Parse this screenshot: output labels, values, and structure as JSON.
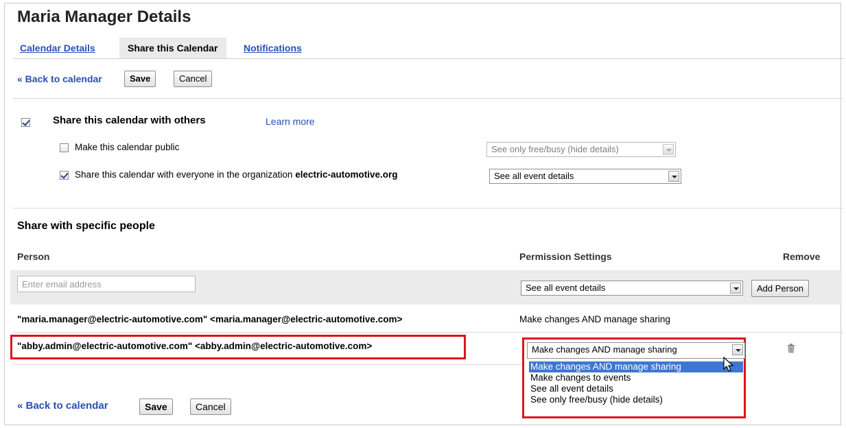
{
  "page": {
    "title": "Maria Manager Details"
  },
  "tabs": [
    {
      "label": "Calendar Details",
      "active": false
    },
    {
      "label": "Share this Calendar",
      "active": true
    },
    {
      "label": "Notifications",
      "active": false
    }
  ],
  "top_actions": {
    "back_label": "« Back to calendar",
    "save_label": "Save",
    "cancel_label": "Cancel"
  },
  "share_section": {
    "share_with_others_label": "Share this calendar with others",
    "share_with_others_checked": true,
    "learn_more": "Learn more",
    "public": {
      "label": "Make this calendar public",
      "checked": false,
      "select_value": "See only free/busy (hide details)"
    },
    "org": {
      "label_prefix": "Share this calendar with everyone in the organization",
      "org_name": "electric-automotive.org",
      "checked": true,
      "select_value": "See all event details"
    }
  },
  "specific_people": {
    "heading": "Share with specific people",
    "col_person": "Person",
    "col_permission": "Permission Settings",
    "col_remove": "Remove",
    "email_placeholder": "Enter email address",
    "new_permission_value": "See all event details",
    "add_person_label": "Add Person",
    "rows": [
      {
        "person": "\"maria.manager@electric-automotive.com\" <maria.manager@electric-automotive.com>",
        "permission": "Make changes AND manage sharing"
      },
      {
        "person": "\"abby.admin@electric-automotive.com\" <abby.admin@electric-automotive.com>",
        "permission": "Make changes AND manage sharing"
      }
    ],
    "dropdown_options": [
      "Make changes AND manage sharing",
      "Make changes to events",
      "See all event details",
      "See only free/busy (hide details)"
    ],
    "dropdown_selected_index": 0
  },
  "bottom_actions": {
    "back_label": "« Back to calendar",
    "save_label": "Save",
    "cancel_label": "Cancel"
  },
  "colors": {
    "link": "#2a4fb6",
    "highlight_border": "#e0121c",
    "dropdown_selected": "#3d77d2"
  },
  "icons": {
    "remove": "trash-icon",
    "cursor": "mouse-pointer-icon"
  }
}
